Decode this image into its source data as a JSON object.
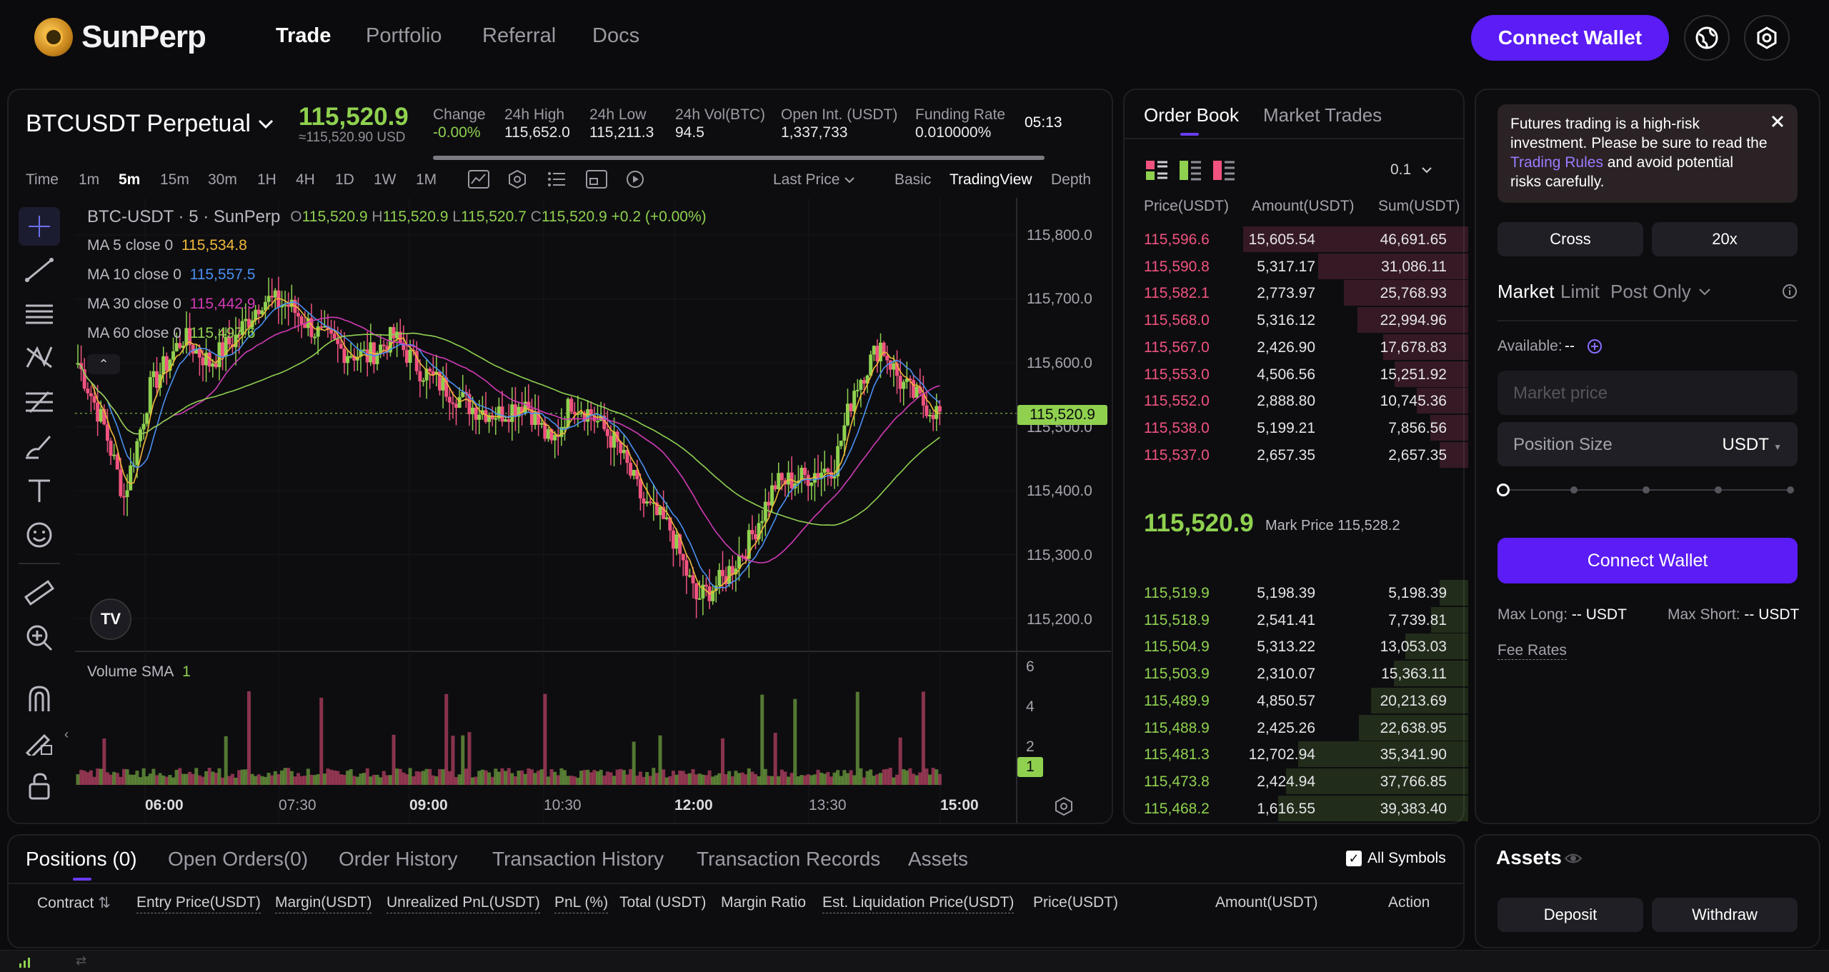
{
  "header": {
    "brand": "SunPerp",
    "nav": [
      "Trade",
      "Portfolio",
      "Referral",
      "Docs"
    ],
    "connect_wallet": "Connect Wallet"
  },
  "ticker": {
    "symbol": "BTCUSDT Perpetual",
    "last_price": "115,520.9",
    "last_price_usd": "≈115,520.90 USD",
    "stats": [
      {
        "label": "Change",
        "value": "-0.00%"
      },
      {
        "label": "24h High",
        "value": "115,652.0"
      },
      {
        "label": "24h Low",
        "value": "115,211.3"
      },
      {
        "label": "24h Vol(BTC)",
        "value": "94.5"
      },
      {
        "label": "Open Int. (USDT)",
        "value": "1,337,733"
      },
      {
        "label": "Funding Rate",
        "value": "0.010000%"
      }
    ],
    "countdown": "05:13"
  },
  "toolbar": {
    "time_label": "Time",
    "timeframes": [
      "1m",
      "5m",
      "15m",
      "30m",
      "1H",
      "4H",
      "1D",
      "1W",
      "1M"
    ],
    "active_timeframe": "5m",
    "price_type": "Last Price",
    "views": [
      "Basic",
      "TradingView",
      "Depth"
    ]
  },
  "chart": {
    "title": "BTC-USDT · 5 · SunPerp",
    "ohlc": {
      "o_label": "O",
      "o": "115,520.9",
      "h_label": "H",
      "h": "115,520.9",
      "l_label": "L",
      "l": "115,520.7",
      "c_label": "C",
      "c": "115,520.9",
      "change": "+0.2 (+0.00%)"
    },
    "ma": [
      {
        "label": "MA 5 close 0",
        "value": "115,534.8",
        "color": "#f0b93a"
      },
      {
        "label": "MA 10 close 0",
        "value": "115,557.5",
        "color": "#4a8ff0"
      },
      {
        "label": "MA 30 close 0",
        "value": "115,442.9",
        "color": "#d13bb5"
      },
      {
        "label": "MA 60 close 0",
        "value": "115,497.6",
        "color": "#8fd14f"
      }
    ],
    "price_axis": [
      "115,800.0",
      "115,700.0",
      "115,600.0",
      "115,500.0",
      "115,400.0",
      "115,300.0",
      "115,200.0"
    ],
    "current_price_tag": "115,520.9",
    "volume_label": "Volume SMA",
    "volume_value": "1",
    "volume_axis": [
      "6",
      "4",
      "2"
    ],
    "volume_tag": "1",
    "time_axis": [
      "06:00",
      "07:30",
      "09:00",
      "10:30",
      "12:00",
      "13:30",
      "15:00"
    ]
  },
  "orderbook": {
    "tabs": [
      "Order Book",
      "Market Trades"
    ],
    "precision": "0.1",
    "columns": [
      "Price(USDT)",
      "Amount(USDT)",
      "Sum(USDT)"
    ],
    "asks": [
      {
        "p": "115,596.6",
        "a": "15,605.54",
        "s": "46,691.65"
      },
      {
        "p": "115,590.8",
        "a": "5,317.17",
        "s": "31,086.11"
      },
      {
        "p": "115,582.1",
        "a": "2,773.97",
        "s": "25,768.93"
      },
      {
        "p": "115,568.0",
        "a": "5,316.12",
        "s": "22,994.96"
      },
      {
        "p": "115,567.0",
        "a": "2,426.90",
        "s": "17,678.83"
      },
      {
        "p": "115,553.0",
        "a": "4,506.56",
        "s": "15,251.92"
      },
      {
        "p": "115,552.0",
        "a": "2,888.80",
        "s": "10,745.36"
      },
      {
        "p": "115,538.0",
        "a": "5,199.21",
        "s": "7,856.56"
      },
      {
        "p": "115,537.0",
        "a": "2,657.35",
        "s": "2,657.35"
      }
    ],
    "mid_price": "115,520.9",
    "mark_price_label": "Mark Price 115,528.2",
    "bids": [
      {
        "p": "115,519.9",
        "a": "5,198.39",
        "s": "5,198.39"
      },
      {
        "p": "115,518.9",
        "a": "2,541.41",
        "s": "7,739.81"
      },
      {
        "p": "115,504.9",
        "a": "5,313.22",
        "s": "13,053.03"
      },
      {
        "p": "115,503.9",
        "a": "2,310.07",
        "s": "15,363.11"
      },
      {
        "p": "115,489.9",
        "a": "4,850.57",
        "s": "20,213.69"
      },
      {
        "p": "115,488.9",
        "a": "2,425.26",
        "s": "22,638.95"
      },
      {
        "p": "115,481.3",
        "a": "12,702.94",
        "s": "35,341.90"
      },
      {
        "p": "115,473.8",
        "a": "2,424.94",
        "s": "37,766.85"
      },
      {
        "p": "115,468.2",
        "a": "1,616.55",
        "s": "39,383.40"
      }
    ]
  },
  "trade": {
    "notice_pre": "Futures trading is a high-risk investment. Please be sure to read the ",
    "notice_link": "Trading Rules",
    "notice_post": " and avoid potential risks carefully.",
    "margin_mode": "Cross",
    "leverage": "20x",
    "order_types": [
      "Market",
      "Limit",
      "Post Only"
    ],
    "available_label": "Available:",
    "available_value": "--",
    "market_price_placeholder": "Market price",
    "position_size_placeholder": "Position Size",
    "position_unit": "USDT",
    "connect_wallet": "Connect Wallet",
    "max_long_label": "Max Long:",
    "max_long_value": "-- USDT",
    "max_short_label": "Max Short:",
    "max_short_value": "-- USDT",
    "fee_rates": "Fee Rates"
  },
  "positions": {
    "tabs": [
      "Positions (0)",
      "Open Orders(0)",
      "Order History",
      "Transaction History",
      "Transaction Records",
      "Assets"
    ],
    "all_symbols": "All Symbols",
    "columns": [
      "Contract",
      "Entry Price(USDT)",
      "Margin(USDT)",
      "Unrealized PnL(USDT)",
      "PnL (%)",
      "Total (USDT)",
      "Margin Ratio",
      "Est. Liquidation Price(USDT)",
      "Price(USDT)",
      "Amount(USDT)",
      "Action"
    ]
  },
  "assets": {
    "title": "Assets",
    "deposit": "Deposit",
    "withdraw": "Withdraw"
  }
}
